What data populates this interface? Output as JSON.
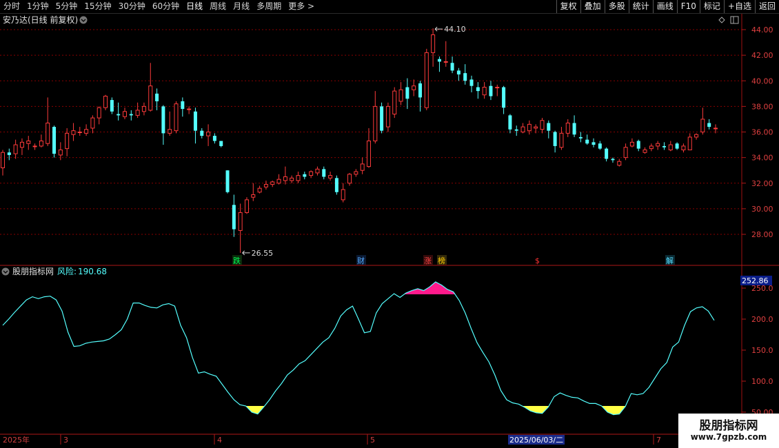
{
  "toolbar": {
    "periods": [
      "分时",
      "1分钟",
      "5分钟",
      "15分钟",
      "30分钟",
      "60分钟",
      "日线",
      "周线",
      "月线",
      "多周期",
      "更多"
    ],
    "active_period": "日线",
    "more_arrow": ">",
    "buttons": [
      "复权",
      "叠加",
      "多股",
      "统计",
      "画线",
      "F10",
      "标记",
      "+自选",
      "返回"
    ]
  },
  "stock": {
    "title": "安乃达(日线 前复权)"
  },
  "price_axis": {
    "ticks": [
      "44.00",
      "42.00",
      "40.00",
      "38.00",
      "36.00",
      "34.00",
      "32.00",
      "30.00",
      "28.00"
    ]
  },
  "annotations": {
    "high_label": "44.10",
    "low_label": "26.55"
  },
  "event_markers": [
    {
      "text": "跌",
      "color": "#00ff55"
    },
    {
      "text": "财",
      "color": "#55aaff"
    },
    {
      "text": "涨",
      "color": "#ff4444"
    },
    {
      "text": "榜",
      "color": "#ffcc00"
    },
    {
      "text": "$",
      "color": "#ff3333"
    },
    {
      "text": "解",
      "color": "#55ddff"
    }
  ],
  "indicator": {
    "name": "股朋指标网",
    "risk_label": "风险:",
    "risk_value": "190.68",
    "current_value_badge": "252.86",
    "ticks": [
      "250.0",
      "200.0",
      "150.0",
      "100.0",
      "50.00"
    ]
  },
  "time_axis": {
    "labels": [
      "2025年",
      "3",
      "4",
      "5",
      "7"
    ],
    "crosshair_date": "2025/06/03/二"
  },
  "watermark": {
    "title": "股朋指标网",
    "url": "www.7gpzb.com"
  },
  "colors": {
    "up": "#ff3b3b",
    "down": "#54ffff",
    "grid": "#8b0000",
    "indicator_line": "#54ffff",
    "low_fill": "#ffff44",
    "high_fill": "#ff1a8c"
  },
  "chart_data": [
    {
      "type": "candlestick",
      "title": "安乃达(日线 前复权)",
      "ylim": [
        26.5,
        44.5
      ],
      "high": 44.1,
      "low": 26.55,
      "candles": [
        [
          33.2,
          34.4,
          34.6,
          32.6
        ],
        [
          34.4,
          34.2,
          34.7,
          33.8
        ],
        [
          34.3,
          35.0,
          35.4,
          33.9
        ],
        [
          34.8,
          35.2,
          35.5,
          34.2
        ],
        [
          35.1,
          35.3,
          35.7,
          34.6
        ],
        [
          34.9,
          34.9,
          35.1,
          34.6
        ],
        [
          34.9,
          35.3,
          35.8,
          34.8
        ],
        [
          35.1,
          36.7,
          38.7,
          34.9
        ],
        [
          36.4,
          34.3,
          36.5,
          34.0
        ],
        [
          34.2,
          34.6,
          35.2,
          33.8
        ],
        [
          34.7,
          35.9,
          36.3,
          34.1
        ],
        [
          35.8,
          36.1,
          36.7,
          35.3
        ],
        [
          36.0,
          36.0,
          36.4,
          35.7
        ],
        [
          35.9,
          36.2,
          36.6,
          35.7
        ],
        [
          36.3,
          37.1,
          37.3,
          35.9
        ],
        [
          37.1,
          37.9,
          38.0,
          36.6
        ],
        [
          37.9,
          38.8,
          38.9,
          37.7
        ],
        [
          38.5,
          37.6,
          38.7,
          37.4
        ],
        [
          37.4,
          37.3,
          38.3,
          36.9
        ],
        [
          37.2,
          37.6,
          37.9,
          37.0
        ],
        [
          37.4,
          37.3,
          37.7,
          36.9
        ],
        [
          37.3,
          37.7,
          38.3,
          37.1
        ],
        [
          37.6,
          38.0,
          38.3,
          37.3
        ],
        [
          37.7,
          39.6,
          41.4,
          37.6
        ],
        [
          39.0,
          38.4,
          39.4,
          37.7
        ],
        [
          38.0,
          35.9,
          38.1,
          35.0
        ],
        [
          35.9,
          36.2,
          37.6,
          35.7
        ],
        [
          36.1,
          38.2,
          38.4,
          35.9
        ],
        [
          38.4,
          37.8,
          38.7,
          37.2
        ],
        [
          37.8,
          37.8,
          38.0,
          37.4
        ],
        [
          37.6,
          36.1,
          37.9,
          35.1
        ],
        [
          36.1,
          35.7,
          36.3,
          35.5
        ],
        [
          35.7,
          36.0,
          36.6,
          34.9
        ],
        [
          35.7,
          35.3,
          35.9,
          35.1
        ],
        [
          35.3,
          34.9,
          35.3,
          34.8
        ],
        [
          33.0,
          31.3,
          33.0,
          31.2
        ],
        [
          30.3,
          28.4,
          31.1,
          27.8
        ],
        [
          28.3,
          29.7,
          30.4,
          26.55
        ],
        [
          29.7,
          30.7,
          30.9,
          29.6
        ],
        [
          30.9,
          31.1,
          32.0,
          30.6
        ],
        [
          31.3,
          31.6,
          31.8,
          31.2
        ],
        [
          31.7,
          31.9,
          32.2,
          31.5
        ],
        [
          31.9,
          32.1,
          32.2,
          31.7
        ],
        [
          32.0,
          32.3,
          32.7,
          31.9
        ],
        [
          32.2,
          32.5,
          33.3,
          31.9
        ],
        [
          32.2,
          32.4,
          32.6,
          32.0
        ],
        [
          32.2,
          32.6,
          32.9,
          32.0
        ],
        [
          32.7,
          32.5,
          32.9,
          32.3
        ],
        [
          32.6,
          32.9,
          33.0,
          32.4
        ],
        [
          32.8,
          33.1,
          33.3,
          32.6
        ],
        [
          33.1,
          32.5,
          33.3,
          32.3
        ],
        [
          32.4,
          32.6,
          32.9,
          32.2
        ],
        [
          32.4,
          31.3,
          32.6,
          31.1
        ],
        [
          30.7,
          31.5,
          32.0,
          30.5
        ],
        [
          32.0,
          32.7,
          32.8,
          31.8
        ],
        [
          32.7,
          32.9,
          33.1,
          32.5
        ],
        [
          33.0,
          33.5,
          34.0,
          32.7
        ],
        [
          33.3,
          35.3,
          36.3,
          33.2
        ],
        [
          35.3,
          38.0,
          39.2,
          35.1
        ],
        [
          38.0,
          36.1,
          38.3,
          35.9
        ],
        [
          36.4,
          38.0,
          38.3,
          36.0
        ],
        [
          37.4,
          39.2,
          39.5,
          37.1
        ],
        [
          38.4,
          39.3,
          39.9,
          38.1
        ],
        [
          39.5,
          38.6,
          40.2,
          37.8
        ],
        [
          39.3,
          39.6,
          40.1,
          38.8
        ],
        [
          39.8,
          38.7,
          40.0,
          37.6
        ],
        [
          37.9,
          42.2,
          42.5,
          37.7
        ],
        [
          42.2,
          43.6,
          44.1,
          41.1
        ],
        [
          41.7,
          41.5,
          41.9,
          40.7
        ],
        [
          41.5,
          41.5,
          43.1,
          41.1
        ],
        [
          41.4,
          40.8,
          41.9,
          40.6
        ],
        [
          40.8,
          40.5,
          41.0,
          40.0
        ],
        [
          40.6,
          40.0,
          41.3,
          39.7
        ],
        [
          40.1,
          39.6,
          40.4,
          39.1
        ],
        [
          39.5,
          39.2,
          39.9,
          38.6
        ],
        [
          38.9,
          39.5,
          39.9,
          38.6
        ],
        [
          39.6,
          38.8,
          40.0,
          38.5
        ],
        [
          39.5,
          39.5,
          39.7,
          38.8
        ],
        [
          39.5,
          37.9,
          39.6,
          37.4
        ],
        [
          37.3,
          36.2,
          37.4,
          35.9
        ],
        [
          36.2,
          36.1,
          36.5,
          35.7
        ],
        [
          36.0,
          36.4,
          36.7,
          35.9
        ],
        [
          36.1,
          36.6,
          36.9,
          35.8
        ],
        [
          36.3,
          36.4,
          36.6,
          35.9
        ],
        [
          36.2,
          36.9,
          37.1,
          35.9
        ],
        [
          36.7,
          36.1,
          36.9,
          35.5
        ],
        [
          36.0,
          34.9,
          36.1,
          34.4
        ],
        [
          34.8,
          35.9,
          36.4,
          34.6
        ],
        [
          35.9,
          36.7,
          37.0,
          35.6
        ],
        [
          36.7,
          35.8,
          37.3,
          35.6
        ],
        [
          35.6,
          35.5,
          36.0,
          35.2
        ],
        [
          35.4,
          35.1,
          35.8,
          35.0
        ],
        [
          35.2,
          35.0,
          35.5,
          34.8
        ],
        [
          35.1,
          34.7,
          35.3,
          34.6
        ],
        [
          34.7,
          33.9,
          34.8,
          33.7
        ],
        [
          33.9,
          33.8,
          34.0,
          33.6
        ],
        [
          33.4,
          33.7,
          33.9,
          33.3
        ],
        [
          34.0,
          34.8,
          35.1,
          33.8
        ],
        [
          34.9,
          35.2,
          35.5,
          34.8
        ],
        [
          35.3,
          34.7,
          35.4,
          34.5
        ],
        [
          34.4,
          34.6,
          34.8,
          34.3
        ],
        [
          34.7,
          34.9,
          35.1,
          34.5
        ],
        [
          34.9,
          35.1,
          35.3,
          34.6
        ],
        [
          34.9,
          34.8,
          35.2,
          34.6
        ],
        [
          34.6,
          35.0,
          35.3,
          34.5
        ],
        [
          35.1,
          34.7,
          35.2,
          34.6
        ],
        [
          34.6,
          34.9,
          35.1,
          34.4
        ],
        [
          34.6,
          35.6,
          35.9,
          34.6
        ],
        [
          35.6,
          35.8,
          35.9,
          35.4
        ],
        [
          36.0,
          37.0,
          37.9,
          35.8
        ],
        [
          36.7,
          36.4,
          37.0,
          36.2
        ],
        [
          36.3,
          36.3,
          36.6,
          35.9
        ]
      ]
    },
    {
      "type": "area",
      "title": "风险",
      "ylim": [
        45,
        265
      ],
      "low_threshold": 60,
      "high_threshold": 240,
      "values": [
        190,
        200,
        211,
        221,
        231,
        236,
        233,
        236,
        237,
        231,
        213,
        179,
        156,
        157,
        161,
        163,
        164,
        165,
        168,
        175,
        183,
        200,
        226,
        226,
        222,
        219,
        218,
        223,
        225,
        221,
        190,
        170,
        138,
        113,
        115,
        111,
        108,
        95,
        82,
        70,
        62,
        60,
        50,
        47,
        58,
        70,
        84,
        96,
        110,
        118,
        128,
        133,
        143,
        153,
        163,
        170,
        185,
        205,
        215,
        221,
        200,
        178,
        180,
        210,
        225,
        233,
        241,
        235,
        242,
        246,
        249,
        246,
        252,
        260,
        255,
        248,
        244,
        230,
        210,
        185,
        162,
        146,
        131,
        110,
        85,
        70,
        65,
        63,
        58,
        52,
        49,
        48,
        58,
        75,
        81,
        77,
        74,
        73,
        68,
        64,
        64,
        60,
        50,
        46,
        47,
        59,
        80,
        78,
        80,
        90,
        105,
        120,
        130,
        155,
        163,
        190,
        212,
        218,
        220,
        213,
        198
      ]
    }
  ]
}
